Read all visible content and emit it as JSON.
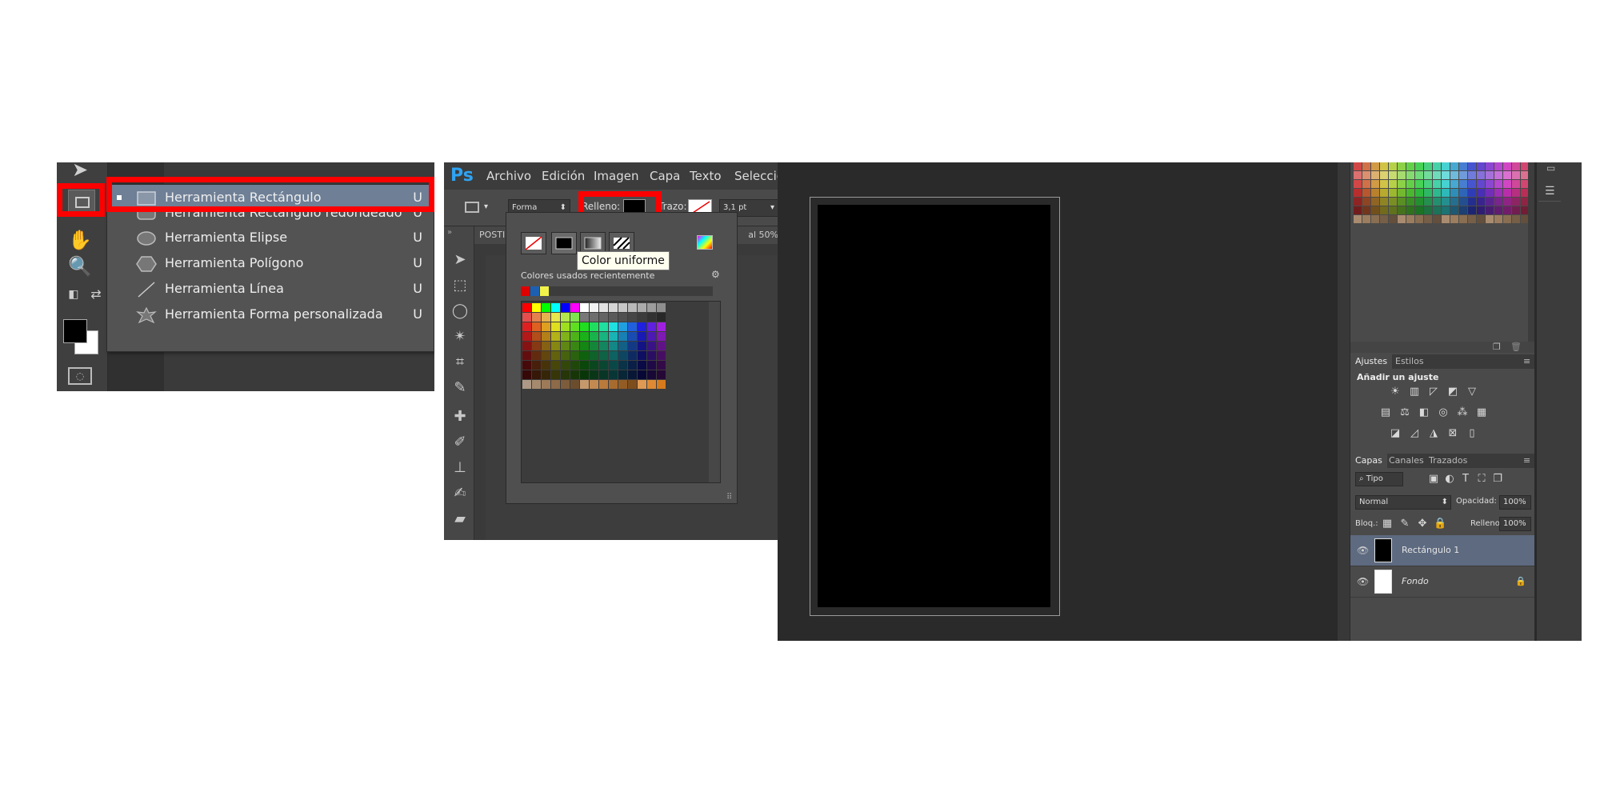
{
  "tool_flyout": {
    "items": [
      {
        "label": "Herramienta Rectángulo",
        "key": "U",
        "selected": true
      },
      {
        "label": "Herramienta Rectángulo redondeado",
        "key": "U"
      },
      {
        "label": "Herramienta Elipse",
        "key": "U"
      },
      {
        "label": "Herramienta Polígono",
        "key": "U"
      },
      {
        "label": "Herramienta Línea",
        "key": "U"
      },
      {
        "label": "Herramienta Forma personalizada",
        "key": "U"
      }
    ],
    "highlight_color": "#ff0000"
  },
  "menubar": {
    "logo": "Ps",
    "items": [
      "Archivo",
      "Edición",
      "Imagen",
      "Capa",
      "Texto",
      "Selección"
    ]
  },
  "options_bar": {
    "mode": "Forma",
    "fill_label": "Relleno:",
    "stroke_label": "Trazo:",
    "stroke_width": "3,1 pt",
    "tab_text": "POSTI",
    "zoom_text": "al 50%"
  },
  "fill_popup": {
    "recent_label": "Colores usados recientemente",
    "recent_colors": [
      "#e00000",
      "#1d5fb3",
      "#f2f24a"
    ],
    "tooltip": "Color uniforme"
  },
  "layers_panel": {
    "adjust_tabs": [
      "Ajustes",
      "Estilos"
    ],
    "adjust_title": "Añadir un ajuste",
    "layer_tabs": [
      "Capas",
      "Canales",
      "Trazados"
    ],
    "filter_kind": "Tipo",
    "blend_mode": "Normal",
    "opacity_label": "Opacidad:",
    "opacity_value": "100%",
    "lock_label": "Bloq.:",
    "fill_label": "Relleno:",
    "fill_value": "100%",
    "layers": [
      {
        "name": "Rectángulo 1",
        "selected": true
      },
      {
        "name": "Fondo",
        "italic": true,
        "locked": true
      }
    ]
  }
}
